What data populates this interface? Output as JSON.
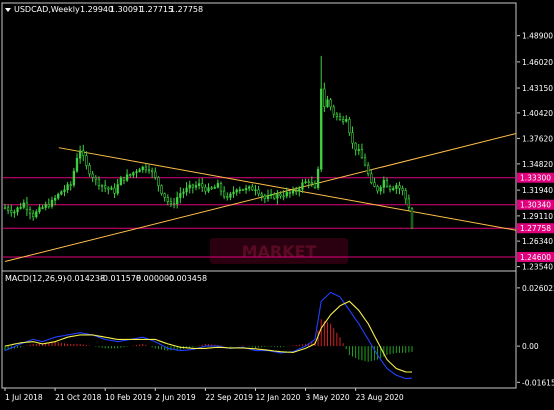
{
  "chart_data": {
    "type": "candlestick",
    "symbol": "USDCAD",
    "timeframe": "Weekly",
    "header_label": "USDCAD,Weekly",
    "ohlc": [
      "1.29940",
      "1.30091",
      "1.27715",
      "1.27758"
    ],
    "price_axis": {
      "ylim": [
        1.2317,
        1.5084
      ],
      "ticks": [
        "1.48900",
        "1.46020",
        "1.43150",
        "1.40420",
        "1.37620",
        "1.34820",
        "1.31940",
        "1.29110",
        "1.26340",
        "1.23540"
      ]
    },
    "price_lines": [
      {
        "label": "1.33300",
        "value": 1.333,
        "color": "#e0007c"
      },
      {
        "label": "1.30340",
        "value": 1.3034,
        "color": "#e0007c"
      },
      {
        "label": "1.27758",
        "value": 1.27758,
        "color": "#e0007c"
      },
      {
        "label": "1.24600",
        "value": 1.246,
        "color": "#e0007c"
      }
    ],
    "trendlines": [
      {
        "name": "falling",
        "color": "#ffc04a",
        "points": [
          [
            "2018-10-21",
            1.366
          ],
          [
            "2020-10-25",
            1.296
          ]
        ]
      },
      {
        "name": "rising",
        "color": "#ffc04a",
        "points": [
          [
            "2018-07-01",
            1.241
          ],
          [
            "2020-10-25",
            1.353
          ]
        ]
      }
    ],
    "x_axis": {
      "ticks": [
        "1 Jul 2018",
        "21 Oct 2018",
        "10 Feb 2019",
        "2 Jun 2019",
        "22 Sep 2019",
        "12 Jan 2020",
        "3 May 2020",
        "23 Aug 2020"
      ]
    },
    "candle_close_path": [
      [
        0,
        1.3
      ],
      [
        3,
        1.296
      ],
      [
        6,
        1.305
      ],
      [
        9,
        1.292
      ],
      [
        12,
        1.3
      ],
      [
        15,
        1.306
      ],
      [
        18,
        1.318
      ],
      [
        21,
        1.325
      ],
      [
        23,
        1.356
      ],
      [
        24,
        1.364
      ],
      [
        26,
        1.345
      ],
      [
        29,
        1.33
      ],
      [
        32,
        1.322
      ],
      [
        35,
        1.318
      ],
      [
        37,
        1.331
      ],
      [
        40,
        1.336
      ],
      [
        43,
        1.344
      ],
      [
        46,
        1.344
      ],
      [
        48,
        1.332
      ],
      [
        50,
        1.318
      ],
      [
        53,
        1.302
      ],
      [
        56,
        1.316
      ],
      [
        59,
        1.322
      ],
      [
        62,
        1.325
      ],
      [
        65,
        1.319
      ],
      [
        68,
        1.324
      ],
      [
        71,
        1.309
      ],
      [
        74,
        1.322
      ],
      [
        77,
        1.32
      ],
      [
        80,
        1.322
      ],
      [
        83,
        1.31
      ],
      [
        86,
        1.313
      ],
      [
        89,
        1.315
      ],
      [
        92,
        1.316
      ],
      [
        95,
        1.326
      ],
      [
        97,
        1.33
      ],
      [
        99,
        1.32
      ],
      [
        100,
        1.34
      ],
      [
        101,
        1.432
      ],
      [
        102,
        1.412
      ],
      [
        103,
        1.418
      ],
      [
        105,
        1.404
      ],
      [
        107,
        1.396
      ],
      [
        109,
        1.4
      ],
      [
        111,
        1.37
      ],
      [
        113,
        1.361
      ],
      [
        115,
        1.348
      ],
      [
        117,
        1.325
      ],
      [
        119,
        1.32
      ],
      [
        121,
        1.33
      ],
      [
        123,
        1.322
      ],
      [
        125,
        1.325
      ],
      [
        127,
        1.318
      ],
      [
        129,
        1.302
      ],
      [
        130,
        1.2776
      ]
    ],
    "candle_count": 131,
    "macd": {
      "label": "MACD(12,26,9)",
      "values": [
        "-0.014238",
        "-0.011578",
        "0.000000",
        "-0.003458"
      ],
      "ylim": [
        -0.0178,
        0.0273
      ],
      "ticks": [
        "0.026023",
        "0.00",
        "-0.016155"
      ],
      "histogram_color_up": "#d42020",
      "histogram_color_down": "#21a021",
      "macd_line_color": "#2040ff",
      "signal_line_color": "#f4f04a",
      "macd_path": [
        [
          0,
          -0.002
        ],
        [
          5,
          0.001
        ],
        [
          9,
          0.003
        ],
        [
          12,
          0.002
        ],
        [
          16,
          0.004
        ],
        [
          20,
          0.005
        ],
        [
          24,
          0.006
        ],
        [
          28,
          0.005
        ],
        [
          32,
          0.003
        ],
        [
          36,
          0.002
        ],
        [
          40,
          0.003
        ],
        [
          44,
          0.004
        ],
        [
          48,
          0.002
        ],
        [
          52,
          -0.001
        ],
        [
          56,
          -0.002
        ],
        [
          60,
          -0.0015
        ],
        [
          64,
          0.0
        ],
        [
          68,
          0.0
        ],
        [
          72,
          -0.001
        ],
        [
          76,
          -0.0005
        ],
        [
          80,
          -0.002
        ],
        [
          84,
          -0.002
        ],
        [
          88,
          -0.003
        ],
        [
          92,
          -0.0025
        ],
        [
          96,
          0.0
        ],
        [
          99,
          0.003
        ],
        [
          101,
          0.02
        ],
        [
          104,
          0.024
        ],
        [
          107,
          0.022
        ],
        [
          110,
          0.016
        ],
        [
          113,
          0.01
        ],
        [
          116,
          0.003
        ],
        [
          119,
          -0.004
        ],
        [
          122,
          -0.01
        ],
        [
          125,
          -0.013
        ],
        [
          128,
          -0.0145
        ],
        [
          130,
          -0.0142
        ]
      ],
      "signal_path": [
        [
          0,
          0.0
        ],
        [
          5,
          0.0015
        ],
        [
          9,
          0.002
        ],
        [
          12,
          0.001
        ],
        [
          16,
          0.002
        ],
        [
          20,
          0.004
        ],
        [
          24,
          0.005
        ],
        [
          28,
          0.005
        ],
        [
          32,
          0.004
        ],
        [
          36,
          0.003
        ],
        [
          40,
          0.003
        ],
        [
          44,
          0.003
        ],
        [
          48,
          0.003
        ],
        [
          52,
          0.001
        ],
        [
          56,
          -0.0005
        ],
        [
          60,
          -0.001
        ],
        [
          64,
          -0.001
        ],
        [
          68,
          -0.0005
        ],
        [
          72,
          -0.0008
        ],
        [
          76,
          -0.0008
        ],
        [
          80,
          -0.0012
        ],
        [
          84,
          -0.0018
        ],
        [
          88,
          -0.0025
        ],
        [
          92,
          -0.0028
        ],
        [
          96,
          -0.001
        ],
        [
          99,
          0.001
        ],
        [
          101,
          0.008
        ],
        [
          104,
          0.014
        ],
        [
          107,
          0.018
        ],
        [
          110,
          0.02
        ],
        [
          113,
          0.016
        ],
        [
          116,
          0.01
        ],
        [
          119,
          0.002
        ],
        [
          122,
          -0.006
        ],
        [
          125,
          -0.01
        ],
        [
          128,
          -0.0115
        ],
        [
          130,
          -0.0116
        ]
      ]
    }
  },
  "watermark": "MARKET"
}
